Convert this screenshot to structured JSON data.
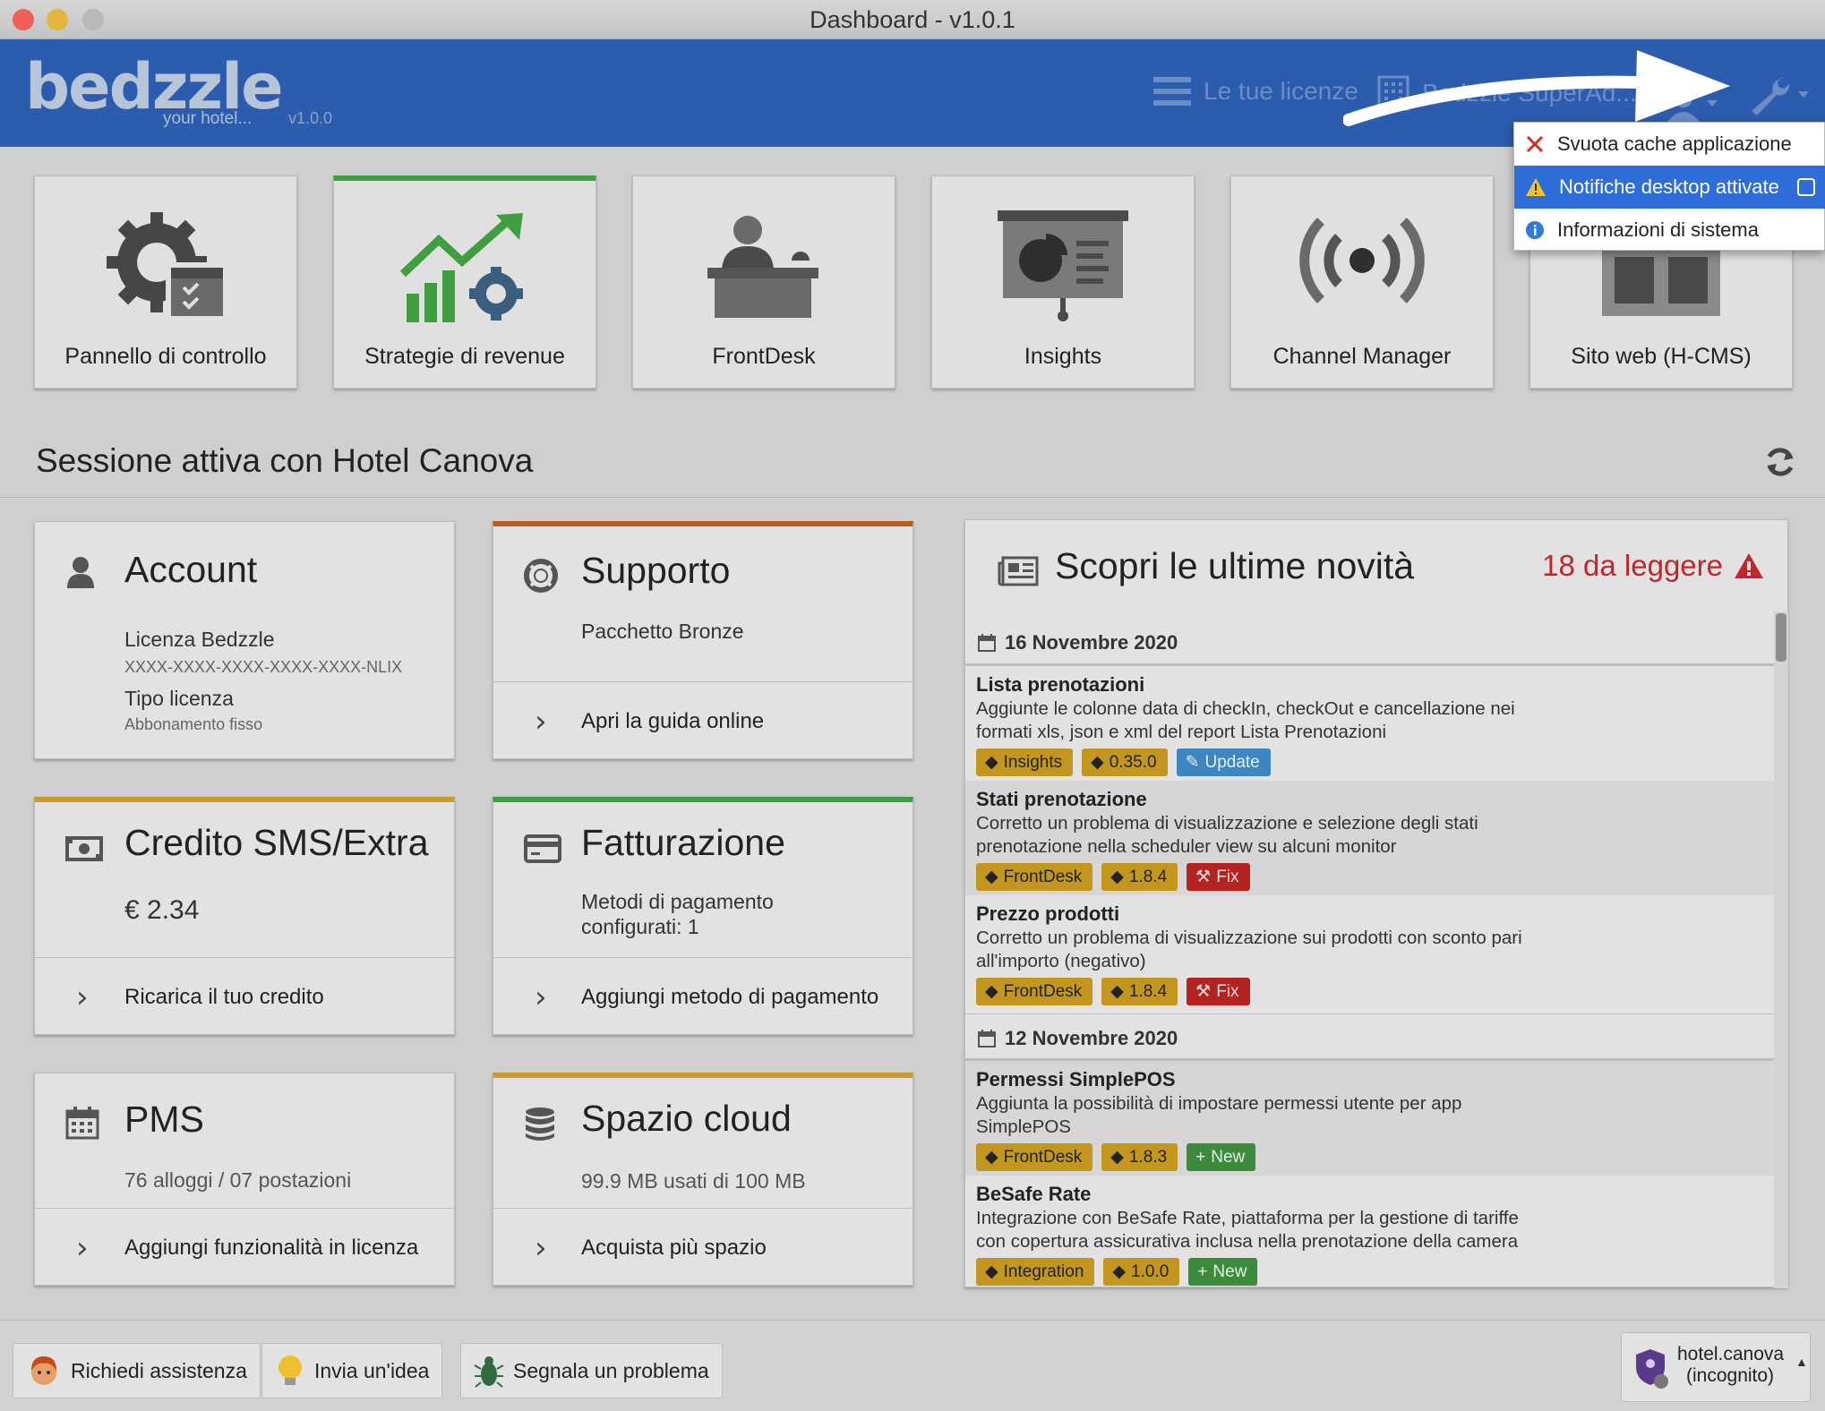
{
  "window": {
    "title": "Dashboard - v1.0.1"
  },
  "header": {
    "logo_text": "bedzzle",
    "logo_tagline": "your hotel...",
    "version": "v1.0.0",
    "licenses_label": "Le tue licenze",
    "hotel_selector_label": "Bedzzle SuperAd...",
    "icons": [
      "menu-icon",
      "building-icon",
      "user-icon",
      "wrench-icon"
    ]
  },
  "settings_menu": {
    "items": [
      {
        "label": "Svuota cache applicazione",
        "icon": "close-icon"
      },
      {
        "label": "Notifiche desktop attivate",
        "icon": "warning-icon",
        "checked": false
      },
      {
        "label": "Informazioni di sistema",
        "icon": "info-icon"
      }
    ]
  },
  "apps": [
    {
      "label": "Pannello di controllo",
      "icon": "gear-calendar-icon"
    },
    {
      "label": "Strategie di revenue",
      "icon": "revenue-chart-icon"
    },
    {
      "label": "FrontDesk",
      "icon": "reception-icon"
    },
    {
      "label": "Insights",
      "icon": "presentation-icon"
    },
    {
      "label": "Channel Manager",
      "icon": "broadcast-icon"
    },
    {
      "label": "Sito web (H-CMS)",
      "icon": "website-icon"
    }
  ],
  "session": {
    "title": "Sessione attiva con Hotel Canova"
  },
  "cards": {
    "account": {
      "title": "Account",
      "license_label": "Licenza Bedzzle",
      "license_key": "XXXX-XXXX-XXXX-XXXX-XXXX-NLIX",
      "type_label": "Tipo licenza",
      "type_value": "Abbonamento fisso"
    },
    "support": {
      "title": "Supporto",
      "package": "Pacchetto Bronze",
      "action": "Apri la guida online"
    },
    "sms": {
      "title": "Credito SMS/Extra",
      "amount": "€ 2.34",
      "action": "Ricarica il tuo credito"
    },
    "billing": {
      "title": "Fatturazione",
      "text_line1": "Metodi di pagamento",
      "text_line2": "configurati: 1",
      "action": "Aggiungi metodo di pagamento"
    },
    "pms": {
      "title": "PMS",
      "units": "76 alloggi / 07 postazioni",
      "action": "Aggiungi funzionalità in licenza"
    },
    "cloud": {
      "title": "Spazio cloud",
      "usage": "99.9 MB usati di 100 MB",
      "action": "Acquista più spazio"
    }
  },
  "news": {
    "title": "Scopri le ultime novità",
    "unread": "18 da leggere",
    "groups": [
      {
        "date": "16 Novembre 2020",
        "items": [
          {
            "title": "Lista prenotazioni",
            "desc_1": "Aggiunte le colonne data di checkIn, checkOut e cancellazione nei",
            "desc_2": "formati xls, json e xml del report Lista Prenotazioni",
            "tags": [
              "Insights",
              "0.35.0",
              "Update"
            ]
          },
          {
            "title": "Stati prenotazione",
            "desc_1": "Corretto un problema di visualizzazione e selezione degli stati",
            "desc_2": "prenotazione nella scheduler view su alcuni monitor",
            "tags": [
              "FrontDesk",
              "1.8.4",
              "Fix"
            ]
          },
          {
            "title": "Prezzo prodotti",
            "desc_1": "Corretto un problema di visualizzazione sui prodotti con sconto pari",
            "desc_2": "all'importo (negativo)",
            "tags": [
              "FrontDesk",
              "1.8.4",
              "Fix"
            ]
          }
        ]
      },
      {
        "date": "12 Novembre 2020",
        "items": [
          {
            "title": "Permessi SimplePOS",
            "desc_1": "Aggiunta la possibilità di impostare permessi utente per app",
            "desc_2": "SimplePOS",
            "tags": [
              "FrontDesk",
              "1.8.3",
              "New"
            ]
          },
          {
            "title": "BeSafe Rate",
            "desc_1": "Integrazione con BeSafe Rate, piattaforma per la gestione di tariffe",
            "desc_2": "con copertura assicurativa inclusa nella prenotazione della camera",
            "tags": [
              "Integration",
              "1.0.0",
              "New"
            ]
          }
        ]
      }
    ]
  },
  "footer": {
    "assist": "Richiedi assistenza",
    "idea": "Invia un'idea",
    "bug": "Segnala un problema",
    "user_line1": "hotel.canova",
    "user_line2": "(incognito)"
  },
  "colors": {
    "header": "#2c5cad",
    "active_green": "#3f9e3f",
    "alert_red": "#c0272d",
    "menu_highlight": "#2f6dd9"
  }
}
